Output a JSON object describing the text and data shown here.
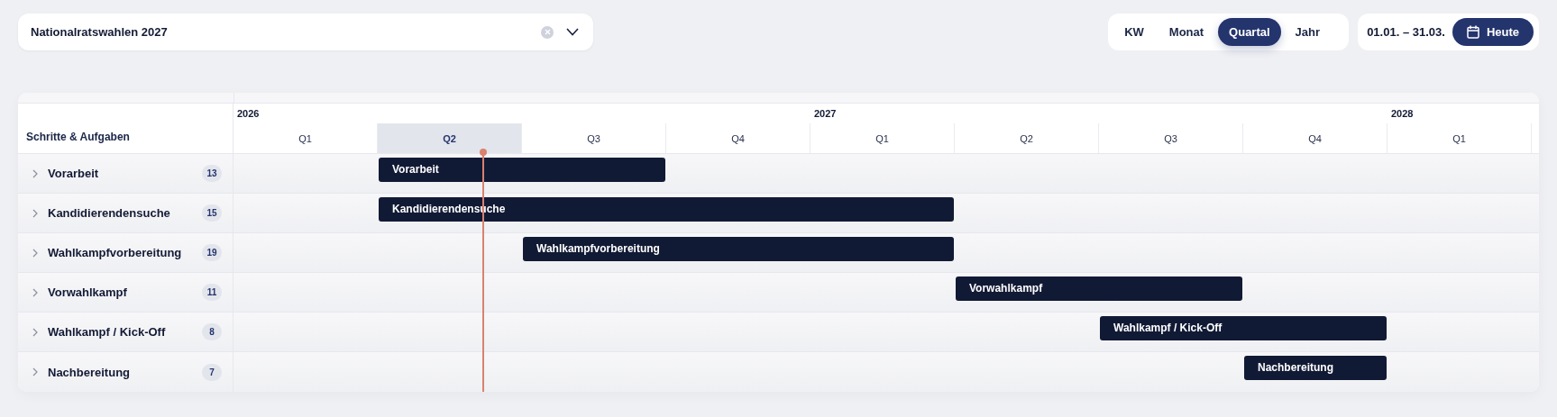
{
  "project_select": {
    "value": "Nationalratswahlen 2027"
  },
  "view_tabs": [
    {
      "label": "KW",
      "selected": false
    },
    {
      "label": "Monat",
      "selected": false
    },
    {
      "label": "Quartal",
      "selected": true
    },
    {
      "label": "Jahr",
      "selected": false
    }
  ],
  "date_range": "01.01. – 31.03.",
  "today_button": "Heute",
  "table": {
    "column_header": "Schritte & Aufgaben",
    "years": [
      {
        "label": "2026",
        "quarters": [
          {
            "label": "Q1",
            "selected": false
          },
          {
            "label": "Q2",
            "selected": true
          },
          {
            "label": "Q3",
            "selected": false
          },
          {
            "label": "Q4",
            "selected": false
          }
        ]
      },
      {
        "label": "2027",
        "quarters": [
          {
            "label": "Q1",
            "selected": false
          },
          {
            "label": "Q2",
            "selected": false
          },
          {
            "label": "Q3",
            "selected": false
          },
          {
            "label": "Q4",
            "selected": false
          }
        ]
      },
      {
        "label": "2028",
        "quarters": [
          {
            "label": "Q1",
            "selected": false
          }
        ]
      }
    ],
    "rows": [
      {
        "name": "Vorarbeit",
        "count": "13",
        "expanded": false,
        "bar": {
          "label": "Vorarbeit"
        }
      },
      {
        "name": "Kandidierendensuche",
        "count": "15",
        "expanded": false,
        "bar": {
          "label": "Kandidierendensuche"
        }
      },
      {
        "name": "Wahlkampfvorbereitung",
        "count": "19",
        "expanded": false,
        "bar": {
          "label": "Wahlkampfvorbereitung"
        }
      },
      {
        "name": "Vorwahlkampf",
        "count": "11",
        "expanded": false,
        "bar": {
          "label": "Vorwahlkampf"
        }
      },
      {
        "name": "Wahlkampf / Kick-Off",
        "count": "8",
        "expanded": false,
        "bar": {
          "label": "Wahlkampf / Kick-Off"
        }
      },
      {
        "name": "Nachbereitung",
        "count": "7",
        "expanded": false,
        "bar": {
          "label": "Nachbereitung"
        }
      }
    ]
  }
}
